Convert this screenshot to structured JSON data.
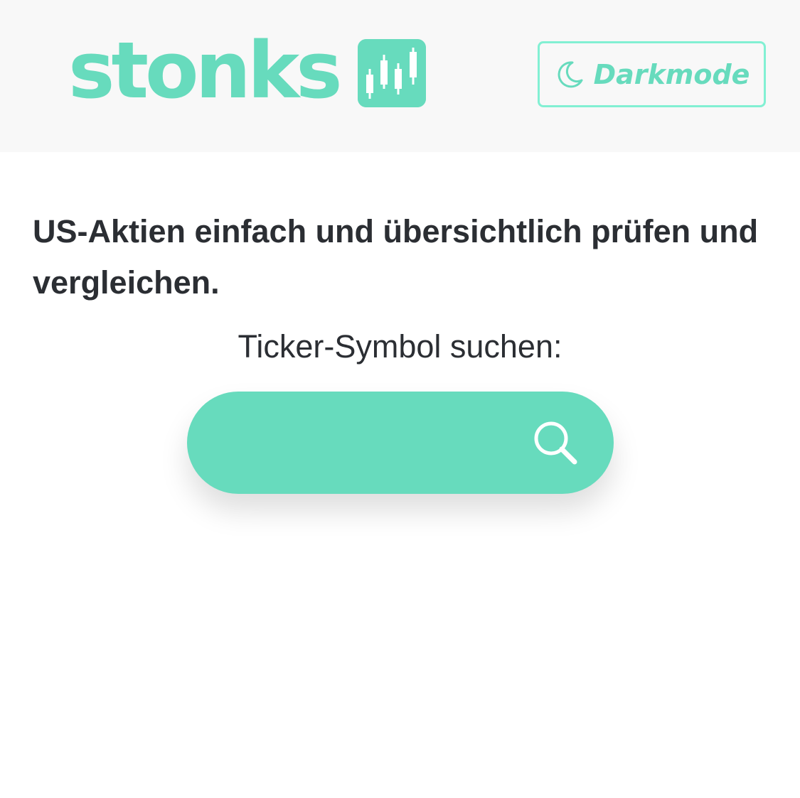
{
  "header": {
    "logo_text": "stonks",
    "logo_icon": "candlestick-chart-icon",
    "darkmode_button": {
      "label": "Darkmode",
      "icon": "moon-icon"
    }
  },
  "main": {
    "headline": "US-Aktien einfach und übersichtlich prüfen und vergleichen.",
    "search": {
      "label": "Ticker-Symbol suchen:",
      "value": "",
      "placeholder": "",
      "icon": "search-icon"
    }
  },
  "colors": {
    "brand": "#67dbbd",
    "brand_border": "#82f0d3",
    "text": "#2b2e33",
    "header_bg": "#f8f8f8",
    "page_bg": "#ffffff"
  }
}
